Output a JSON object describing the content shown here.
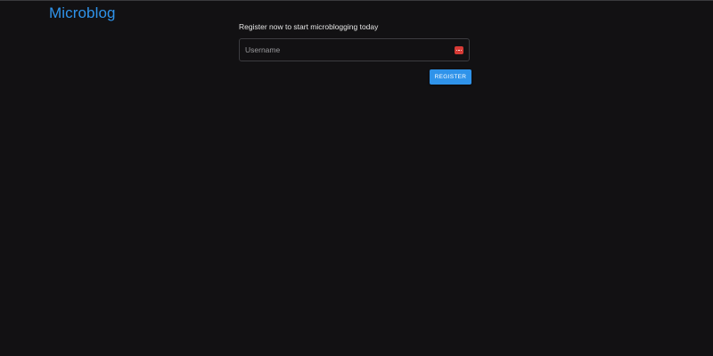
{
  "app": {
    "brand": "Microblog"
  },
  "register": {
    "tagline": "Register now to start microblogging today",
    "username_placeholder": "Username",
    "username_value": "",
    "password_manager_icon": "password-manager-icon",
    "submit_label": "REGISTER"
  },
  "colors": {
    "background": "#121113",
    "accent": "#2f93ea",
    "icon_red": "#d63a35"
  }
}
